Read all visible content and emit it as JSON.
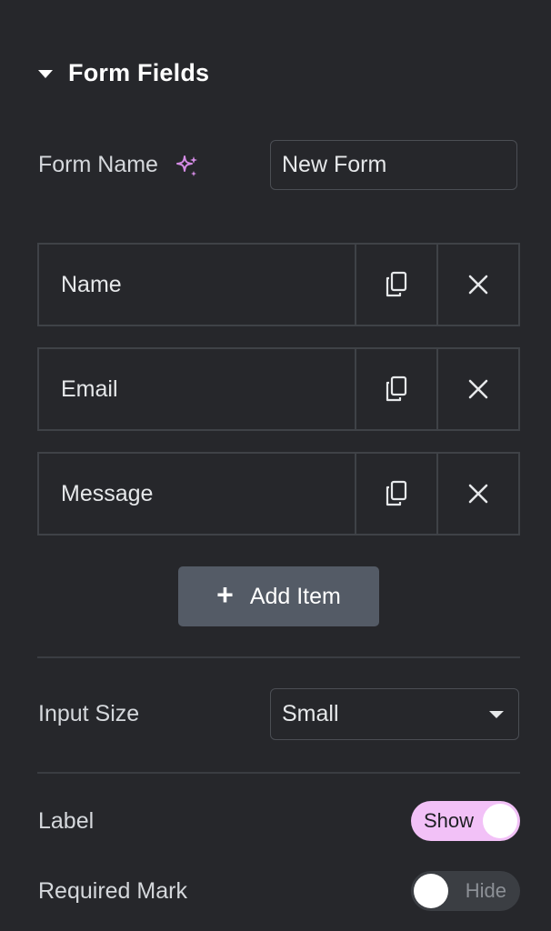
{
  "section": {
    "title": "Form Fields",
    "caret_icon": "caret-down-icon"
  },
  "form_name": {
    "label": "Form Name",
    "ai_icon": "sparkle-icon",
    "value": "New Form"
  },
  "fields": [
    {
      "label": "Name",
      "duplicate_icon": "copy-icon",
      "remove_icon": "close-icon"
    },
    {
      "label": "Email",
      "duplicate_icon": "copy-icon",
      "remove_icon": "close-icon"
    },
    {
      "label": "Message",
      "duplicate_icon": "copy-icon",
      "remove_icon": "close-icon"
    }
  ],
  "add_item": {
    "icon": "plus-icon",
    "label": "Add Item"
  },
  "input_size": {
    "label": "Input Size",
    "selected": "Small"
  },
  "label_toggle": {
    "label": "Label",
    "state_text": "Show",
    "on": true
  },
  "required_toggle": {
    "label": "Required Mark",
    "state_text": "Hide",
    "on": false
  },
  "colors": {
    "background": "#26272b",
    "border": "#3f4247",
    "button": "#545b66",
    "accent_pink": "#f2c1f7",
    "sparkle": "#d58ce6"
  }
}
